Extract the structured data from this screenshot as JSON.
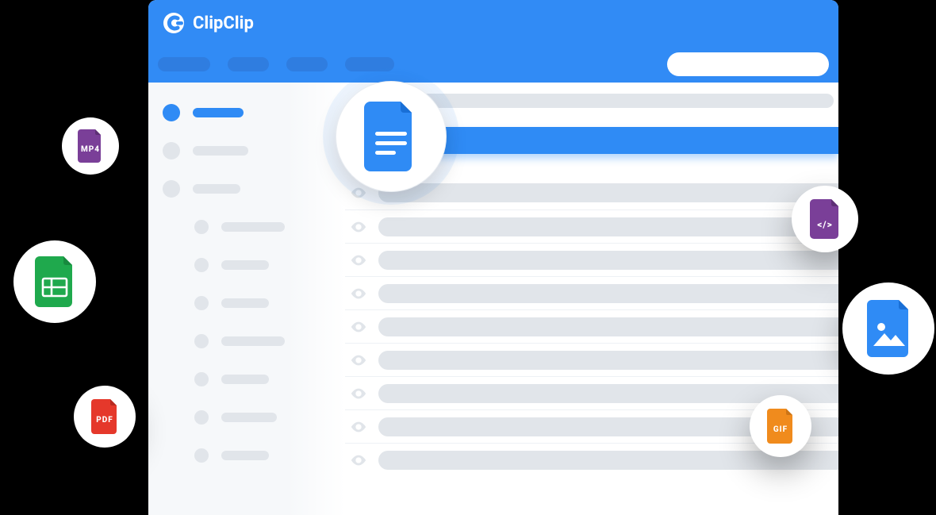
{
  "app": {
    "name": "ClipClip"
  },
  "bubbles": {
    "mp4": {
      "label": "MP4",
      "color": "#7A3F98"
    },
    "sheet": {
      "label": "",
      "color": "#1FA94D"
    },
    "pdf": {
      "label": "PDF",
      "color": "#E5382B"
    },
    "code": {
      "label": "</>",
      "color": "#7A3F98"
    },
    "image": {
      "label": "",
      "color": "#2F8BF5"
    },
    "gif": {
      "label": "GIF",
      "color": "#F08B1D"
    },
    "doc": {
      "label": "",
      "color": "#2F8BF5"
    }
  },
  "sidebar": {
    "groups": [
      {
        "active": true
      },
      {
        "active": false
      },
      {
        "active": false
      }
    ],
    "items": [
      {},
      {},
      {},
      {},
      {},
      {},
      {}
    ]
  },
  "rows": [
    {},
    {},
    {},
    {},
    {},
    {},
    {},
    {},
    {}
  ]
}
